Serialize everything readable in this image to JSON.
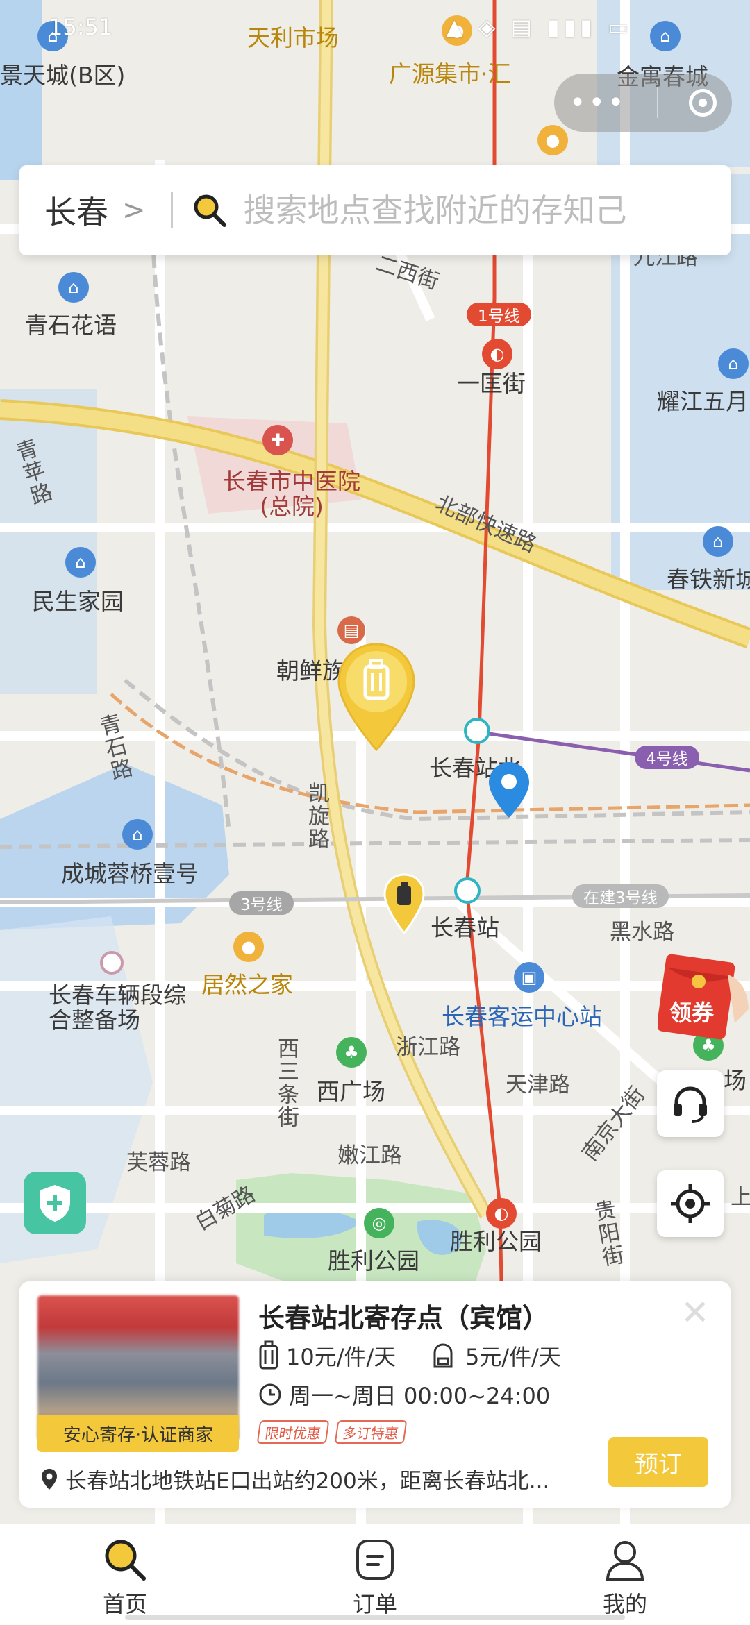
{
  "status": {
    "time": "15:51"
  },
  "header": {
    "city": "长春",
    "search_placeholder": "搜索地点查找附近的存知己"
  },
  "map": {
    "labels": {
      "jingtiancheng": "景天城(B区)",
      "tianli": "天利市场",
      "guangyuan": "广源集市·汇",
      "jinyu": "金寓春城",
      "jiujiang": "九江路",
      "qingshi": "青石花语",
      "erxi": "二西街",
      "yiguo": "一匡街",
      "yaojiang": "耀江五月",
      "hospital": "长春市中医院(总院)",
      "beibu": "北部快速路",
      "qingping": "青苹路",
      "chuntie": "春铁新城",
      "minsheng": "民生家园",
      "chaoxian": "朝鲜族学校",
      "qingshilu": "青石路",
      "station_north": "长春站北",
      "kaixuan": "凯旋路",
      "chengcheng": "成城蓉桥壹号",
      "station": "长春站",
      "heishui": "黑水路",
      "chelianduan": "长春车辆段综合整备场",
      "jura": "居然之家",
      "keyun": "长春客运中心站",
      "xisan": "西三条街",
      "zhejiang": "浙江路",
      "xiguangchang": "西广场",
      "tianjin": "天津路",
      "nanjing": "南京大街",
      "furong": "芙蓉路",
      "nenjiang": "嫩江路",
      "baiju": "白菊路",
      "shengli_park": "胜利公园",
      "shengli": "胜利公园",
      "guiyang": "贵阳街",
      "plaza": "场",
      "shang": "上"
    },
    "metro": {
      "line1": "1号线",
      "line4": "4号线",
      "line3": "3号线",
      "line3_building": "在建3号线"
    }
  },
  "floating": {
    "coupon_label": "领券"
  },
  "card": {
    "title": "长春站北寄存点（宾馆）",
    "badge": "安心寄存·认证商家",
    "price_large": "10元/件/天",
    "price_small": "5元/件/天",
    "hours": "周一~周日 00:00~24:00",
    "tags": [
      "限时优惠",
      "多订特惠"
    ],
    "address": "长春站北地铁站E口出站约200米，距离长春站北...",
    "book_label": "预订"
  },
  "tabs": [
    {
      "label": "首页",
      "icon": "search-icon"
    },
    {
      "label": "订单",
      "icon": "order-icon"
    },
    {
      "label": "我的",
      "icon": "user-icon"
    }
  ],
  "colors": {
    "accent": "#f3c93b",
    "metro_line1": "#e24a32",
    "metro_line4": "#8b5fb0",
    "highway": "#f2d26a",
    "water": "#b3d2f0",
    "park": "#c6e6c0",
    "location_pin": "#2a8be0"
  }
}
